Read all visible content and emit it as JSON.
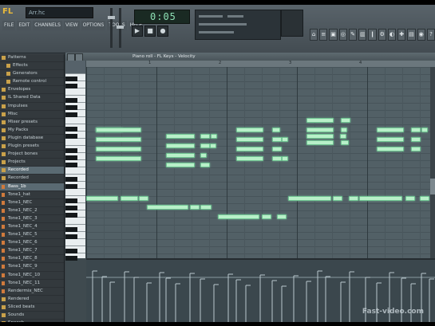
{
  "toolbar": {
    "logo": "FL",
    "hint": "Arr.hc",
    "menu": [
      "FILE",
      "EDIT",
      "CHANNELS",
      "VIEW",
      "OPTIONS",
      "TOOLS",
      "HELP"
    ],
    "time_display": "0:05",
    "transport": [
      "▶",
      "■",
      "●"
    ],
    "tool_icons": [
      "⌂",
      "≡",
      "▣",
      "◎",
      "✎",
      "▥",
      "❙",
      "⚙",
      "◐",
      "✚",
      "▤",
      "◉",
      "?"
    ]
  },
  "browser": {
    "items": [
      {
        "label": "Patterns",
        "kind": "folder"
      },
      {
        "label": "Effects",
        "kind": "folder",
        "sub": true
      },
      {
        "label": "Generators",
        "kind": "folder",
        "sub": true
      },
      {
        "label": "Remote control",
        "kind": "folder",
        "sub": true
      },
      {
        "label": "Envelopes",
        "kind": "folder"
      },
      {
        "label": "IL Shared Data",
        "kind": "folder"
      },
      {
        "label": "Impulses",
        "kind": "folder"
      },
      {
        "label": "Misc",
        "kind": "folder"
      },
      {
        "label": "Mixer presets",
        "kind": "folder"
      },
      {
        "label": "My Packs",
        "kind": "folder"
      },
      {
        "label": "Plugin database",
        "kind": "folder"
      },
      {
        "label": "Plugin presets",
        "kind": "folder"
      },
      {
        "label": "Project bones",
        "kind": "folder"
      },
      {
        "label": "Projects",
        "kind": "folder"
      },
      {
        "label": "Recorded",
        "kind": "folder",
        "sel": true
      },
      {
        "label": "Recorded",
        "kind": "folder"
      },
      {
        "label": "Bass_1b",
        "kind": "file",
        "sel": true
      },
      {
        "label": "Tone1_hat",
        "kind": "file"
      },
      {
        "label": "Tone1_NEC",
        "kind": "file"
      },
      {
        "label": "Tone1_NEC_2",
        "kind": "file"
      },
      {
        "label": "Tone1_NEC_3",
        "kind": "file"
      },
      {
        "label": "Tone1_NEC_4",
        "kind": "file"
      },
      {
        "label": "Tone1_NEC_5",
        "kind": "file"
      },
      {
        "label": "Tone1_NEC_6",
        "kind": "file"
      },
      {
        "label": "Tone1_NEC_7",
        "kind": "file"
      },
      {
        "label": "Tone1_NEC_8",
        "kind": "file"
      },
      {
        "label": "Tone1_NEC_9",
        "kind": "file"
      },
      {
        "label": "Tone1_NEC_10",
        "kind": "file"
      },
      {
        "label": "Tone1_NEC_11",
        "kind": "file"
      },
      {
        "label": "Rendermix_NEC",
        "kind": "file"
      },
      {
        "label": "Rendered",
        "kind": "folder"
      },
      {
        "label": "Sliced beats",
        "kind": "folder"
      },
      {
        "label": "Sounds",
        "kind": "folder"
      },
      {
        "label": "Speech",
        "kind": "folder"
      }
    ]
  },
  "piano_roll": {
    "title": "Piano roll - FL Keys - Velocity",
    "bars": [
      "1",
      "2",
      "3",
      "4"
    ],
    "watermark": "Fast-video.com"
  }
}
